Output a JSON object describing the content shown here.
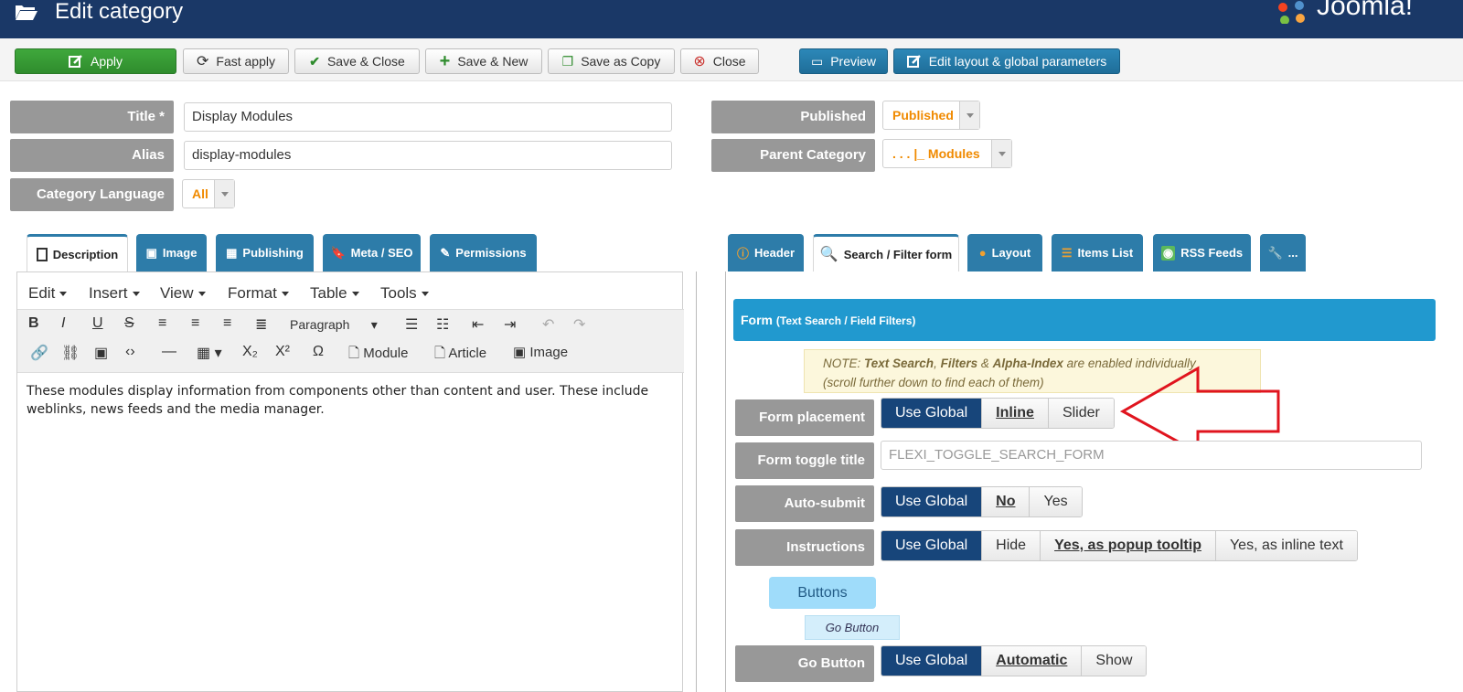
{
  "header": {
    "title": "Edit category",
    "brand": "Joomla!"
  },
  "toolbar": {
    "apply": "Apply",
    "fast_apply": "Fast apply",
    "save_close": "Save & Close",
    "save_new": "Save & New",
    "save_copy": "Save as Copy",
    "close": "Close",
    "preview": "Preview",
    "edit_layout": "Edit layout & global parameters"
  },
  "fields": {
    "title_label": "Title *",
    "title_value": "Display Modules",
    "alias_label": "Alias",
    "alias_value": "display-modules",
    "language_label": "Category Language",
    "language_value": "All",
    "published_label": "Published",
    "published_value": "Published",
    "parent_label": "Parent Category",
    "parent_value": ". . . |_ Modules"
  },
  "left_tabs": [
    "Description",
    "Image",
    "Publishing",
    "Meta / SEO",
    "Permissions"
  ],
  "right_tabs": [
    "Header",
    "Search / Filter form",
    "Layout",
    "Items List",
    "RSS Feeds",
    "..."
  ],
  "editor": {
    "menus": [
      "Edit",
      "Insert",
      "View",
      "Format",
      "Table",
      "Tools"
    ],
    "format_select": "Paragraph",
    "insert_module": "Module",
    "insert_article": "Article",
    "insert_image": "Image",
    "content": "These modules display information from components other than content and user. These include weblinks, news feeds and the media manager."
  },
  "panel": {
    "heading": "Form",
    "heading_sub": "(Text Search / Field Filters)",
    "note_prefix": "NOTE: ",
    "note_bold1": "Text Search",
    "note_sep1": ", ",
    "note_bold2": "Filters",
    "note_sep2": " & ",
    "note_bold3": "Alpha-Index",
    "note_rest": " are enabled individually",
    "note_line2": "(scroll further down to find each of them)",
    "form_placement_label": "Form placement",
    "form_placement_options": [
      "Use Global",
      "Inline",
      "Slider"
    ],
    "toggle_title_label": "Form toggle title",
    "toggle_title_placeholder": "FLEXI_TOGGLE_SEARCH_FORM",
    "autosubmit_label": "Auto-submit",
    "autosubmit_options": [
      "Use Global",
      "No",
      "Yes"
    ],
    "instructions_label": "Instructions",
    "instructions_options": [
      "Use Global",
      "Hide",
      "Yes, as popup tooltip",
      "Yes, as inline text"
    ],
    "buttons_label": "Buttons",
    "go_button_badge": "Go Button",
    "go_button_label": "Go Button",
    "go_button_options": [
      "Use Global",
      "Automatic",
      "Show"
    ]
  },
  "colors": {
    "header_bg": "#1a3867",
    "accent_blue": "#2d7ca9",
    "selected": "#17457a",
    "apply_green": "#3fa83c",
    "arrow_red": "#e0141e"
  }
}
